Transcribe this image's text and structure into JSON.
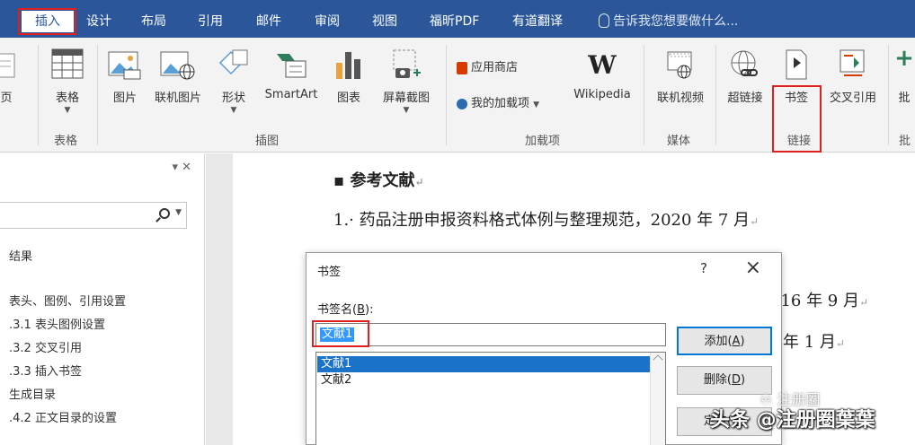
{
  "ribbon_tabs": [
    {
      "label": "插入",
      "active": true
    },
    {
      "label": "设计"
    },
    {
      "label": "布局"
    },
    {
      "label": "引用"
    },
    {
      "label": "邮件"
    },
    {
      "label": "审阅"
    },
    {
      "label": "视图"
    },
    {
      "label": "福昕PDF"
    },
    {
      "label": "有道翻译"
    }
  ],
  "tell_me": "告诉我您想要做什么...",
  "ribbon": {
    "page_label": "页",
    "table_label": "表格",
    "table_group": "表格",
    "picture_label": "图片",
    "online_picture_label": "联机图片",
    "shapes_label": "形状",
    "smartart_label": "SmartArt",
    "chart_label": "图表",
    "screenshot_label": "屏幕截图",
    "illustrations_group": "插图",
    "store_label": "应用商店",
    "my_addins_label": "我的加载项",
    "wikipedia_label": "Wikipedia",
    "addins_group": "加载项",
    "online_video_label": "联机视频",
    "media_group": "媒体",
    "hyperlink_label": "超链接",
    "bookmark_label": "书签",
    "crossref_label": "交叉引用",
    "links_group": "链接",
    "comment_label": "批",
    "comment_group": "批"
  },
  "pane": {
    "controls": "▾  ✕",
    "results_label": "结果",
    "headings": [
      "表头、图例、引用设置",
      ".3.1 表头图例设置",
      ".3.2 交叉引用",
      ".3.3 插入书签",
      "生成目录",
      ".4.2 正文目录的设置"
    ]
  },
  "document": {
    "heading": "▪ 参考文献",
    "line1": "1.· 药品注册申报资料格式体例与整理规范，2020 年 7 月",
    "line2_tail": "016 年 9 月",
    "line3_tail": "年 1 月"
  },
  "dialog": {
    "title": "书签",
    "help": "?",
    "close": "×",
    "name_label": "书签名(",
    "name_key": "B",
    "name_suffix": "):",
    "name_value": "文献1",
    "list_items": [
      "文献1",
      "文献2"
    ],
    "add_label": "添加(",
    "add_key": "A",
    "delete_label": "删除(",
    "delete_key": "D",
    "goto_label": "定位(",
    "goto_key": "G",
    "button_suffix": ")"
  },
  "watermark": {
    "line1": "头条 @注册圈葉葉",
    "line2": "♾ 注册圈"
  },
  "colors": {
    "tabbar": "#2b579a",
    "highlight": "#e02020",
    "selection": "#1a73c9"
  }
}
